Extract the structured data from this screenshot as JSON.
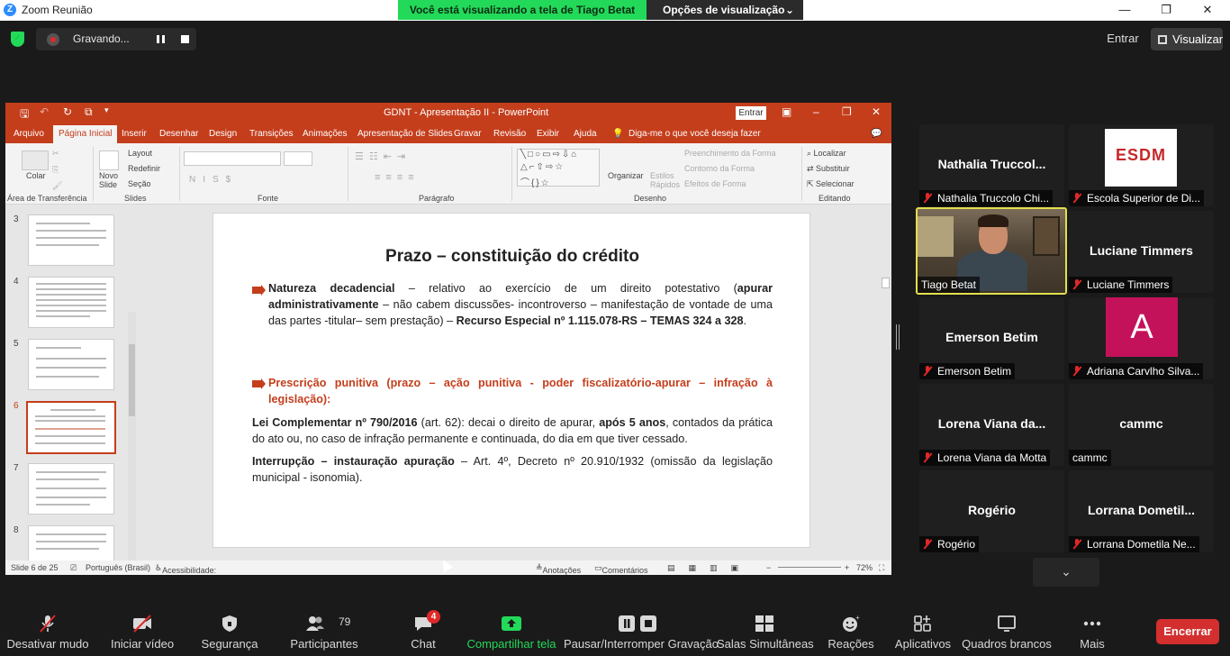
{
  "window": {
    "title": "Zoom Reunião"
  },
  "banner": {
    "viewing": "Você está visualizando a tela de Tiago Betat",
    "options": "Opções de visualização"
  },
  "recording": {
    "label": "Gravando..."
  },
  "top_right": {
    "join": "Entrar",
    "view": "Visualizar"
  },
  "ppt": {
    "doc_title": "GDNT - Apresentação II  -  PowerPoint",
    "signin": "Entrar",
    "tabs": [
      "Arquivo",
      "Página Inicial",
      "Inserir",
      "Desenhar",
      "Design",
      "Transições",
      "Animações",
      "Apresentação de Slides",
      "Gravar",
      "Revisão",
      "Exibir",
      "Ajuda",
      "Diga-me o que você deseja fazer"
    ],
    "ribbon": {
      "paste": "Colar",
      "clipboard": "Área de Transferência",
      "new_slide": "Novo Slide",
      "layout": "Layout",
      "reset": "Redefinir",
      "section": "Seção",
      "slides": "Slides",
      "font": "Fonte",
      "paragraph": "Parágrafo",
      "arrange": "Organizar",
      "quick_styles": "Estilos Rápidos",
      "shape_fill": "Preenchimento da Forma",
      "shape_outline": "Contorno da Forma",
      "shape_effects": "Efeitos de Forma",
      "drawing": "Desenho",
      "find": "Localizar",
      "replace": "Substituir",
      "select": "Selecionar",
      "editing": "Editando"
    },
    "thumb_numbers": [
      "3",
      "4",
      "5",
      "6",
      "7",
      "8"
    ],
    "slide": {
      "title": "Prazo – constituição do crédito",
      "b1_bold1": "Natureza decadencial",
      "b1_text1": " – relativo ao exercício de um direito potestativo (",
      "b1_bold2": "apurar administrativamente",
      "b1_text2": " – não cabem discussões- incontroverso – manifestação de vontade de uma das partes -titular– sem prestação) – ",
      "b1_bold3": "Recurso Especial nº 1.115.078-RS – TEMAS 324 a 328",
      "b1_text3": ".",
      "b2": "Prescrição punitiva (prazo – ação punitiva - poder fiscalizatório-apurar – infração à legislação):",
      "p3_bold1": "Lei Complementar nº 790/2016",
      "p3_text1": " (art. 62): decai o direito de apurar, ",
      "p3_bold2": "após 5 anos",
      "p3_text2": ", contados da prática do ato ou, no caso de infração permanente e continuada, do dia em que tiver cessado.",
      "p4_bold": "Interrupção – instauração apuração",
      "p4_text": "  – Art. 4º, Decreto nº 20.910/1932 (omissão da legislação municipal - isonomia)."
    },
    "status": {
      "slide": "Slide 6 de 25",
      "language": "Português (Brasil)",
      "accessibility": "Acessibilidade: investigar",
      "notes": "Anotações",
      "comments": "Comentários",
      "zoom": "72%"
    }
  },
  "participants": [
    {
      "tile": "Nathalia  Truccol...",
      "caption": "Nathalia Truccolo Chi...",
      "muted": true
    },
    {
      "tile": "ESDM",
      "caption": "Escola Superior de Di...",
      "muted": true
    },
    {
      "tile": "",
      "caption": "Tiago Betat",
      "muted": false
    },
    {
      "tile": "Luciane Timmers",
      "caption": "Luciane Timmers",
      "muted": true
    },
    {
      "tile": "Emerson Betim",
      "caption": "Emerson Betim",
      "muted": true
    },
    {
      "tile": "A",
      "caption": "Adriana Carvlho Silva...",
      "muted": true
    },
    {
      "tile": "Lorena Viana da...",
      "caption": "Lorena Viana da Motta",
      "muted": true
    },
    {
      "tile": "cammc",
      "caption": "cammc",
      "muted": false
    },
    {
      "tile": "Rogério",
      "caption": "Rogério",
      "muted": true
    },
    {
      "tile": "Lorrana  Dometil...",
      "caption": "Lorrana Dometila Ne...",
      "muted": true
    }
  ],
  "toolbar": {
    "mute": "Desativar mudo",
    "video": "Iniciar vídeo",
    "security": "Segurança",
    "participants": "Participantes",
    "participants_count": "79",
    "chat": "Chat",
    "chat_badge": "4",
    "share": "Compartilhar tela",
    "pause_rec": "Pausar/Interromper Gravação",
    "breakout": "Salas Simultâneas",
    "reactions": "Reações",
    "apps": "Aplicativos",
    "whiteboards": "Quadros brancos",
    "more": "Mais",
    "end": "Encerrar"
  },
  "colors": {
    "ppt_accent": "#c43e1c",
    "share_green": "#23d959",
    "end_red": "#d32f2f",
    "active_speaker": "#e3e04c"
  }
}
